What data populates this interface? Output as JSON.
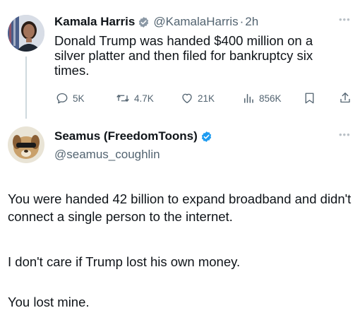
{
  "tweet": {
    "author_name": "Kamala Harris",
    "handle": "@KamalaHarris",
    "separator": "·",
    "time": "2h",
    "text": "Donald Trump was handed $400 million on a silver platter and then filed for bankruptcy six times.",
    "more_icon": "ellipsis-icon",
    "actions": {
      "replies": "5K",
      "reposts": "4.7K",
      "likes": "21K",
      "views": "856K"
    }
  },
  "reply": {
    "author_name": "Seamus (FreedomToons)",
    "handle": "@seamus_coughlin",
    "more_icon": "ellipsis-icon",
    "paragraphs": [
      "You were handed 42 billion to expand broadband and didn't connect a single person to the internet.",
      "I don't care if Trump lost his own money.",
      "You lost mine."
    ]
  },
  "colors": {
    "verified_badge": "#1d9bf0",
    "text_primary": "#0f1419",
    "text_secondary": "#536471"
  }
}
